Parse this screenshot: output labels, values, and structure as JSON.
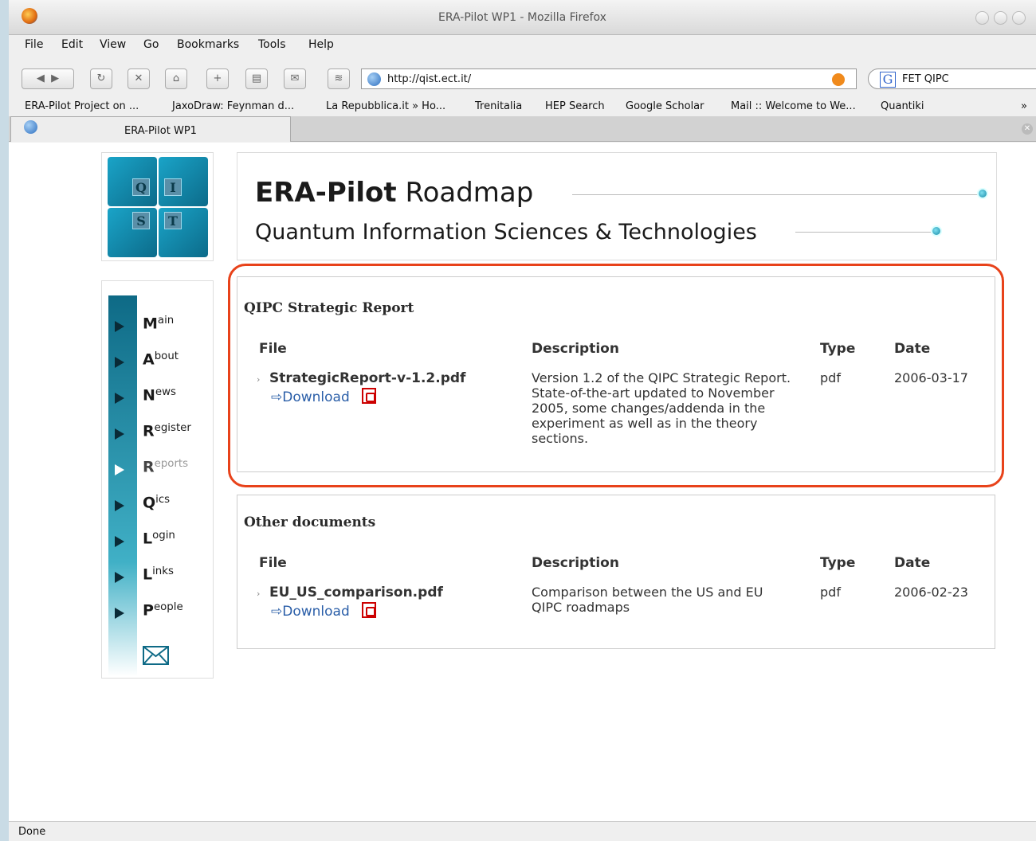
{
  "window": {
    "title": "ERA-Pilot WP1 - Mozilla Firefox"
  },
  "menu": [
    "File",
    "Edit",
    "View",
    "Go",
    "Bookmarks",
    "Tools",
    "Help"
  ],
  "toolbar": {
    "url": "http://qist.ect.it/",
    "search_value": "FET QIPC"
  },
  "bookmarks": [
    "ERA-Pilot Project on ...",
    "JaxoDraw: Feynman d...",
    "La Repubblica.it » Ho...",
    "Trenitalia",
    "HEP Search",
    "Google Scholar",
    "Mail :: Welcome to We...",
    "Quantiki"
  ],
  "tab": {
    "label": "ERA-Pilot WP1"
  },
  "banner": {
    "title_bold": "ERA-Pilot",
    "title_rest": " Roadmap",
    "subtitle": "Quantum Information Sciences & Technologies"
  },
  "nav": [
    {
      "initial": "M",
      "rest": "ain"
    },
    {
      "initial": "A",
      "rest": "bout"
    },
    {
      "initial": "N",
      "rest": "ews"
    },
    {
      "initial": "R",
      "rest": "egister"
    },
    {
      "initial": "R",
      "rest": "eports"
    },
    {
      "initial": "Q",
      "rest": "ics"
    },
    {
      "initial": "L",
      "rest": "ogin"
    },
    {
      "initial": "L",
      "rest": "inks"
    },
    {
      "initial": "P",
      "rest": "eople"
    }
  ],
  "strategic": {
    "heading": "QIPC Strategic Report",
    "columns": {
      "file": "File",
      "description": "Description",
      "type": "Type",
      "date": "Date"
    },
    "row": {
      "file": "StrategicReport-v-1.2.pdf",
      "download": "Download",
      "description": "Version 1.2 of the QIPC Strategic Report. State-of-the-art updated to November 2005, some changes/addenda in the experiment as well as in the theory sections.",
      "type": "pdf",
      "date": "2006-03-17"
    }
  },
  "other": {
    "heading": "Other documents",
    "columns": {
      "file": "File",
      "description": "Description",
      "type": "Type",
      "date": "Date"
    },
    "row": {
      "file": "EU_US_comparison.pdf",
      "download": "Download",
      "description": "Comparison between the US and EU QIPC roadmaps",
      "type": "pdf",
      "date": "2006-02-23"
    }
  },
  "status": {
    "text": "Done"
  },
  "colors": {
    "highlight": "#e8421a",
    "link": "#2a5ea8",
    "nav_bar": "#0e6a86"
  }
}
